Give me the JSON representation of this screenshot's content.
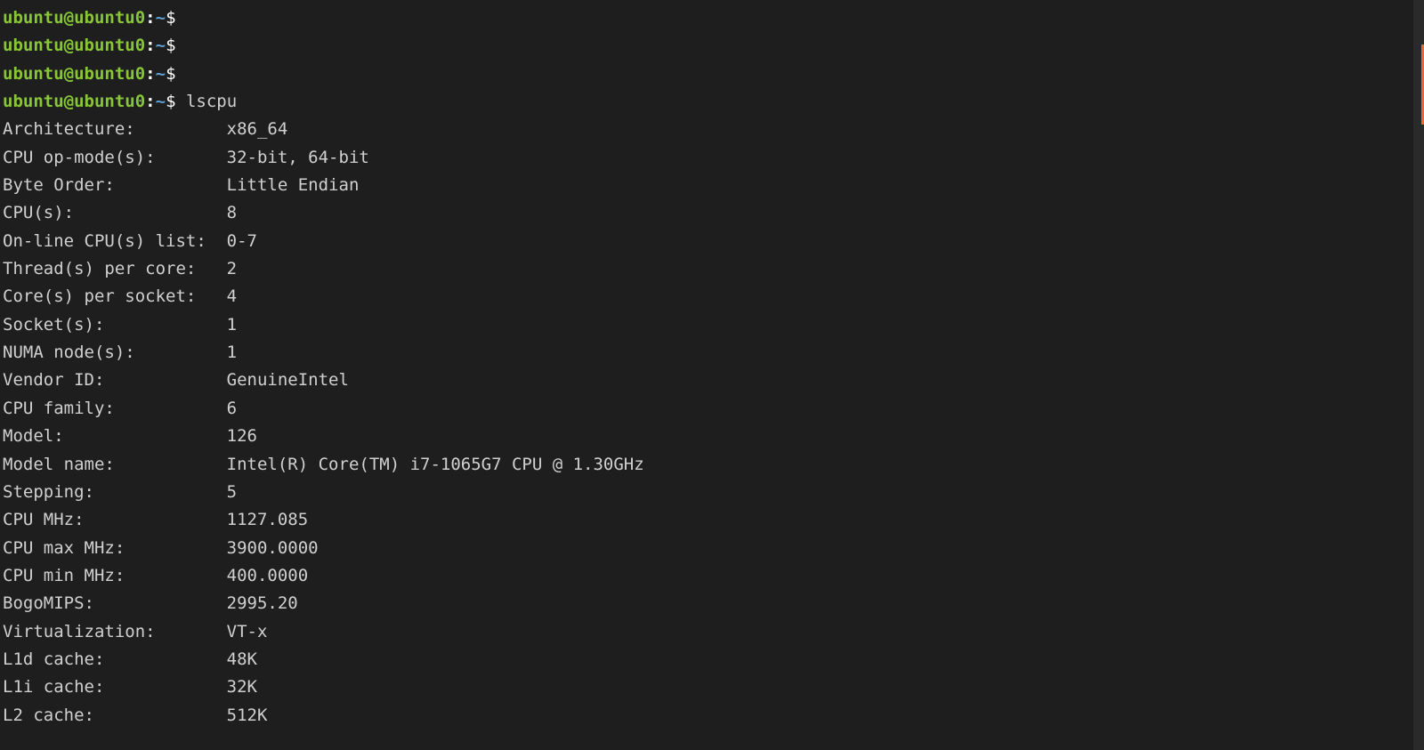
{
  "prompt": {
    "user_host": "ubuntu@ubuntu0",
    "colon": ":",
    "path": "~",
    "dollar": "$"
  },
  "command": "lscpu",
  "empty_prompts": 3,
  "label_col_width": 22,
  "rows": [
    {
      "label": "Architecture:",
      "value": "x86_64"
    },
    {
      "label": "CPU op-mode(s):",
      "value": "32-bit, 64-bit"
    },
    {
      "label": "Byte Order:",
      "value": "Little Endian"
    },
    {
      "label": "CPU(s):",
      "value": "8"
    },
    {
      "label": "On-line CPU(s) list:",
      "value": "0-7"
    },
    {
      "label": "Thread(s) per core:",
      "value": "2"
    },
    {
      "label": "Core(s) per socket:",
      "value": "4"
    },
    {
      "label": "Socket(s):",
      "value": "1"
    },
    {
      "label": "NUMA node(s):",
      "value": "1"
    },
    {
      "label": "Vendor ID:",
      "value": "GenuineIntel"
    },
    {
      "label": "CPU family:",
      "value": "6"
    },
    {
      "label": "Model:",
      "value": "126"
    },
    {
      "label": "Model name:",
      "value": "Intel(R) Core(TM) i7-1065G7 CPU @ 1.30GHz"
    },
    {
      "label": "Stepping:",
      "value": "5"
    },
    {
      "label": "CPU MHz:",
      "value": "1127.085"
    },
    {
      "label": "CPU max MHz:",
      "value": "3900.0000"
    },
    {
      "label": "CPU min MHz:",
      "value": "400.0000"
    },
    {
      "label": "BogoMIPS:",
      "value": "2995.20"
    },
    {
      "label": "Virtualization:",
      "value": "VT-x"
    },
    {
      "label": "L1d cache:",
      "value": "48K"
    },
    {
      "label": "L1i cache:",
      "value": "32K"
    },
    {
      "label": "L2 cache:",
      "value": "512K"
    }
  ]
}
